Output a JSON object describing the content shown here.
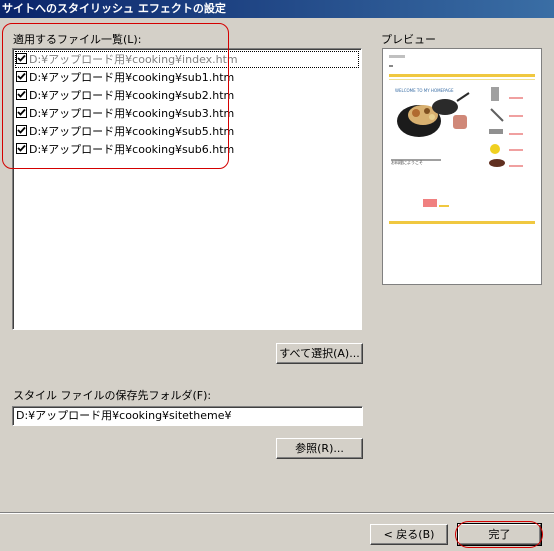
{
  "window": {
    "title": "サイトへのスタイリッシュ エフェクトの設定"
  },
  "file_list": {
    "label": "適用するファイル一覧(L):",
    "items": [
      {
        "text": "D:¥アップロード用¥cooking¥index.htm",
        "checked": true
      },
      {
        "text": "D:¥アップロード用¥cooking¥sub1.htm",
        "checked": true
      },
      {
        "text": "D:¥アップロード用¥cooking¥sub2.htm",
        "checked": true
      },
      {
        "text": "D:¥アップロード用¥cooking¥sub3.htm",
        "checked": true
      },
      {
        "text": "D:¥アップロード用¥cooking¥sub5.htm",
        "checked": true
      },
      {
        "text": "D:¥アップロード用¥cooking¥sub6.htm",
        "checked": true
      }
    ]
  },
  "select_all_button": "すべて選択(A)...",
  "style_folder": {
    "label": "スタイル ファイルの保存先フォルダ(F):",
    "value": "D:¥アップロード用¥cooking¥sitetheme¥"
  },
  "browse_button": "参照(R)...",
  "preview": {
    "label": "プレビュー",
    "banner": "WELCOME TO MY HOMEPAGE",
    "body_text": "お料理にようこそ"
  },
  "footer": {
    "back_button": "< 戻る(B)",
    "finish_button": "完了"
  },
  "colors": {
    "highlight_circle": "#d40000",
    "preview_accent": "#f0c840"
  }
}
